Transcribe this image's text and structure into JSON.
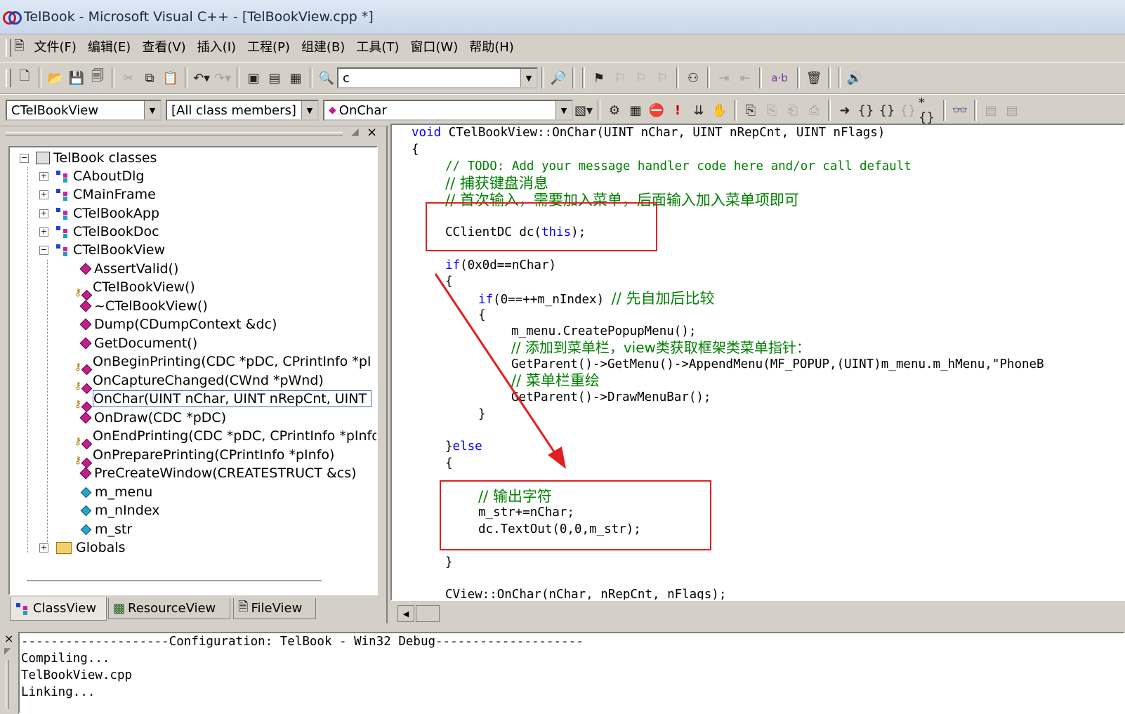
{
  "window": {
    "title": "TelBook - Microsoft Visual C++ - [TelBookView.cpp *]"
  },
  "menu": [
    {
      "label": "文件(F)"
    },
    {
      "label": "编辑(E)"
    },
    {
      "label": "查看(V)"
    },
    {
      "label": "插入(I)"
    },
    {
      "label": "工程(P)"
    },
    {
      "label": "组建(B)"
    },
    {
      "label": "工具(T)"
    },
    {
      "label": "窗口(W)"
    },
    {
      "label": "帮助(H)"
    }
  ],
  "toolbar": {
    "find_value": "c",
    "ab_label": "a·b"
  },
  "wizardbar": {
    "class_combo": "CTelBookView",
    "filter_combo": "[All class members]",
    "member_combo": "OnChar"
  },
  "workspace": {
    "root": "TelBook classes",
    "classes": [
      {
        "label": "CAboutDlg"
      },
      {
        "label": "CMainFrame"
      },
      {
        "label": "CTelBookApp"
      },
      {
        "label": "CTelBookDoc"
      },
      {
        "label": "CTelBookView"
      }
    ],
    "members": [
      {
        "label": "AssertValid()",
        "kind": "method"
      },
      {
        "label": "CTelBookView()",
        "kind": "protected-method"
      },
      {
        "label": "~CTelBookView()",
        "kind": "method"
      },
      {
        "label": "Dump(CDumpContext &dc)",
        "kind": "method"
      },
      {
        "label": "GetDocument()",
        "kind": "method"
      },
      {
        "label": "OnBeginPrinting(CDC *pDC, CPrintInfo *pI",
        "kind": "protected-method"
      },
      {
        "label": "OnCaptureChanged(CWnd *pWnd)",
        "kind": "protected-method"
      },
      {
        "label": "OnChar(UINT nChar, UINT nRepCnt, UINT",
        "kind": "protected-method"
      },
      {
        "label": "OnDraw(CDC *pDC)",
        "kind": "method"
      },
      {
        "label": "OnEndPrinting(CDC *pDC, CPrintInfo *pInfo",
        "kind": "protected-method"
      },
      {
        "label": "OnPreparePrinting(CPrintInfo *pInfo)",
        "kind": "protected-method"
      },
      {
        "label": "PreCreateWindow(CREATESTRUCT &cs)",
        "kind": "method"
      },
      {
        "label": "m_menu",
        "kind": "member"
      },
      {
        "label": "m_nIndex",
        "kind": "member"
      },
      {
        "label": "m_str",
        "kind": "member"
      }
    ],
    "globals": "Globals",
    "tabs": [
      {
        "label": "ClassView"
      },
      {
        "label": "ResourceView"
      },
      {
        "label": "FileView"
      }
    ]
  },
  "code": {
    "l01a": "void",
    "l01b": " CTelBookView::OnChar(UINT nChar, UINT nRepCnt, UINT nFlags)",
    "l02": "{",
    "l03": "// TODO: Add your message handler code here and/or call default",
    "l04": "// 捕获键盘消息",
    "l05": "// 首次输入，需要加入菜单，后面输入加入菜单项即可",
    "l06a": "CClientDC dc(",
    "l06b": "this",
    "l06c": ");",
    "l07a": "if",
    "l07b": "(0x0d==nChar)",
    "l08": "{",
    "l09a": "if",
    "l09b": "(0==++m_nIndex) ",
    "l09c": "// 先自加后比较",
    "l10": "{",
    "l11": "m_menu.CreatePopupMenu();",
    "l12": "// 添加到菜单栏，view类获取框架类菜单指针：",
    "l13": "GetParent()->GetMenu()->AppendMenu(MF_POPUP,(UINT)m_menu.m_hMenu,\"PhoneB",
    "l14": "// 菜单栏重绘",
    "l15": "GetParent()->DrawMenuBar();",
    "l16": "}",
    "l17a": "}",
    "l17b": "else",
    "l18": "{",
    "l19": "// 输出字符",
    "l20": "m_str+=nChar;",
    "l21": "dc.TextOut(0,0,m_str);",
    "l22": "}",
    "l23": "CView::OnChar(nChar, nRepCnt, nFlags);"
  },
  "output": {
    "lines": [
      "--------------------Configuration: TelBook - Win32 Debug--------------------",
      "Compiling...",
      "TelBookView.cpp",
      "Linking..."
    ]
  },
  "colors": {
    "keyword": "#0000ff",
    "comment": "#008000",
    "annotation": "#e02020"
  }
}
